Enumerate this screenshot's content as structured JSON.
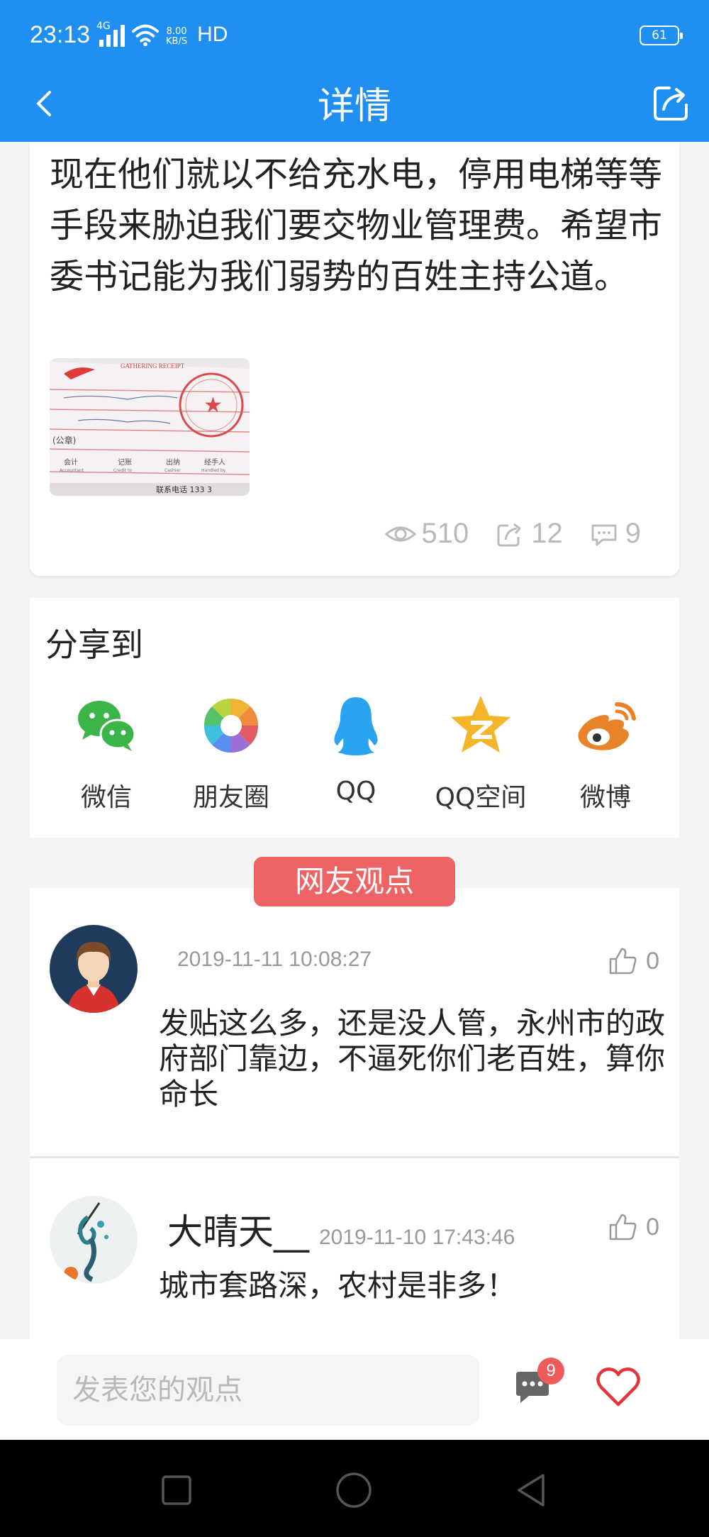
{
  "status_bar": {
    "time": "23:13",
    "network_type": "4G",
    "speed_value": "8.00",
    "speed_unit": "KB/S",
    "hd": "HD",
    "battery": "61"
  },
  "header": {
    "title": "详情",
    "back_icon": "chevron-left-icon",
    "share_icon": "share-icon"
  },
  "article": {
    "body": "现在他们就以不给充水电，停用电梯等等手段来胁迫我们要交物业管理费。希望市委书记能为我们弱势的百姓主持公道。",
    "image_text": {
      "header": "GATHERING RECEIPT",
      "stamp": "★",
      "row_public": "(公章)",
      "labels": [
        "会计",
        "记账",
        "出纳",
        "经手人"
      ],
      "labels_en": [
        "Accountant",
        "Credit to",
        "Cashier",
        "Handled by"
      ],
      "footer": "联系电话  133 3"
    },
    "stats": {
      "views": "510",
      "shares": "12",
      "comments": "9"
    }
  },
  "share": {
    "title": "分享到",
    "items": [
      {
        "label": "微信",
        "icon": "wechat-icon"
      },
      {
        "label": "朋友圈",
        "icon": "moments-icon"
      },
      {
        "label": "QQ",
        "icon": "qq-icon"
      },
      {
        "label": "QQ空间",
        "icon": "qzone-icon"
      },
      {
        "label": "微博",
        "icon": "weibo-icon"
      }
    ]
  },
  "comments": {
    "section_title": "网友观点",
    "items": [
      {
        "user": "",
        "date": "2019-11-11 10:08:27",
        "likes": "0",
        "text": "发贴这么多，还是没人管，永州市的政府部门靠边，不逼死你们老百姓，算你命长"
      },
      {
        "user": "大晴天__",
        "date": "2019-11-10 17:43:46",
        "likes": "0",
        "text": "城市套路深，农村是非多！"
      }
    ]
  },
  "input_bar": {
    "placeholder": "发表您的观点",
    "comment_badge": "9"
  },
  "colors": {
    "primary": "#1f8ff2",
    "pill": "#ee6464",
    "badge": "#ef5b5b",
    "muted": "#b9b9b9"
  }
}
